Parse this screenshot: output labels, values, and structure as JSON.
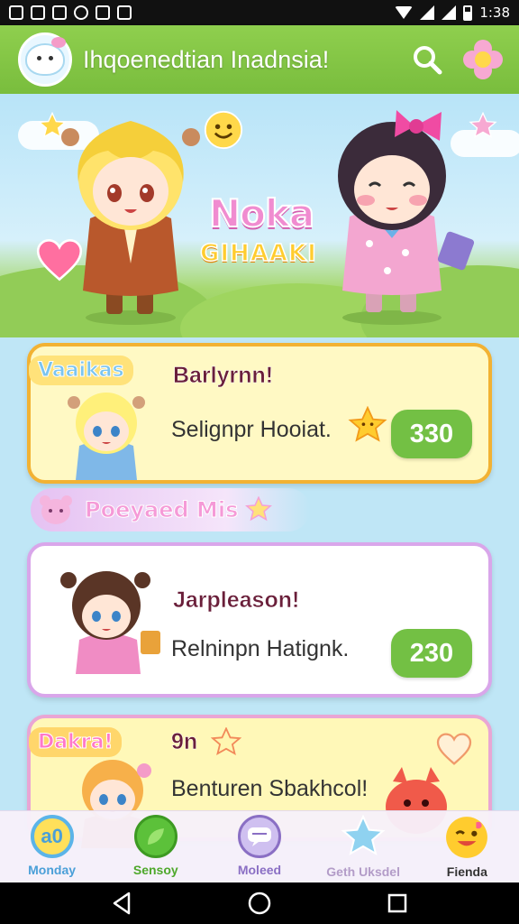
{
  "status_bar": {
    "time": "1:38"
  },
  "header": {
    "title": "Ihqoenedtian Inadnsia!",
    "search_icon": "search-icon",
    "menu_icon": "flower-icon"
  },
  "hero": {
    "title": "Noka",
    "subtitle": "GIHAAKI"
  },
  "cards": [
    {
      "ribbon": "Vaaikas",
      "title": "Barlyrnn!",
      "description": "Selignpr Hooiat.",
      "badge": "330"
    },
    {
      "ribbon": "",
      "title": "Jarpleason!",
      "description": "Relninpn Hatignk.",
      "badge": "230"
    },
    {
      "ribbon": "Dakra!",
      "title": "9n",
      "description": "Benturen Sbakhcol!",
      "badge": ""
    }
  ],
  "section_label": "Poeyaed Mis",
  "nav": [
    {
      "label": "Monday",
      "icon_text": "a0",
      "color": "#4a9fd8"
    },
    {
      "label": "Sensoy",
      "icon_text": "",
      "color": "#4ea82b"
    },
    {
      "label": "Moleed",
      "icon_text": "",
      "color": "#8a6fc4"
    },
    {
      "label": "Geth Uksdel",
      "icon_text": "",
      "color": "#b39cc8"
    },
    {
      "label": "Fienda",
      "icon_text": "",
      "color": "#333333"
    }
  ],
  "colors": {
    "header": "#7fc444",
    "badge": "#73c044",
    "accent_pink": "#f08cd0"
  }
}
